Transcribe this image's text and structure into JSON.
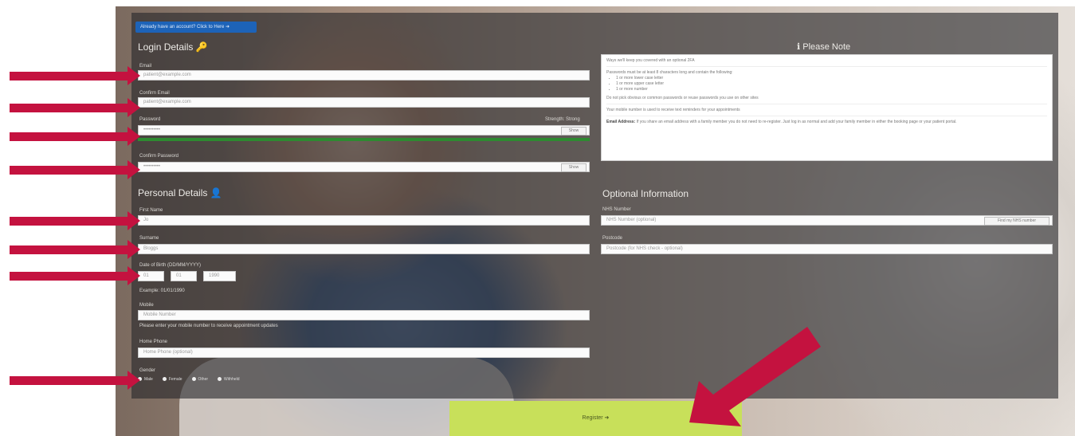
{
  "signin_button": "Already have an account? Click to Here ➜",
  "login": {
    "title": "Login Details 🔑",
    "email_label": "Email",
    "email_value": "patient@example.com",
    "confirm_email_label": "Confirm Email",
    "confirm_email_value": "patient@example.com",
    "password_label": "Password",
    "password_strength": "Strength: Strong",
    "password_value": "••••••••••",
    "show_label": "Show",
    "confirm_password_label": "Confirm Password",
    "confirm_password_value": "••••••••••"
  },
  "note": {
    "title": "ℹ Please Note",
    "para1": "Ways we'll keep you covered with an optional 2FA",
    "para2": "Passwords must be at least 8 characters long and contain the following:",
    "bullets": [
      "1 or more lower case letter",
      "1 or more upper case letter",
      "1 or more number"
    ],
    "para3": "Do not pick obvious or common passwords or reuse passwords you use on other sites",
    "para4": "Your mobile number is used to receive text reminders for your appointments",
    "para5_bold": "Email Address:",
    "para5": " If you share an email address with a family member you do not need to re-register. Just log in as normal and add your family member in either the booking page or your patient portal."
  },
  "personal": {
    "title": "Personal Details 👤",
    "first_name_label": "First Name",
    "first_name_value": "Jo",
    "surname_label": "Surname",
    "surname_value": "Bloggs",
    "dob_label": "Date of Birth (DD/MM/YYYY)",
    "dob_day": "01",
    "dob_month": "01",
    "dob_year": "1990",
    "dob_hint": "Example: 01/01/1990",
    "mobile_label": "Mobile",
    "mobile_value": "Mobile Number",
    "mobile_hint": "Please enter your mobile number to receive appointment updates",
    "home_phone_label": "Home Phone",
    "home_phone_value": "Home Phone (optional)",
    "gender_label": "Gender",
    "gender_options": [
      "Male",
      "Female",
      "Other",
      "Withheld"
    ]
  },
  "optional": {
    "title": "Optional Information",
    "nhs_label": "NHS Number",
    "nhs_value": "NHS Number (optional)",
    "nhs_button": "Find my NHS number",
    "postcode_label": "Postcode",
    "postcode_value": "Postcode (for NHS check - optional)"
  },
  "register_button": "Register ➜",
  "colors": {
    "arrow": "#c4123f",
    "register": "#c8e05a",
    "primary": "#1d63b8",
    "strength": "#2d8a30"
  }
}
